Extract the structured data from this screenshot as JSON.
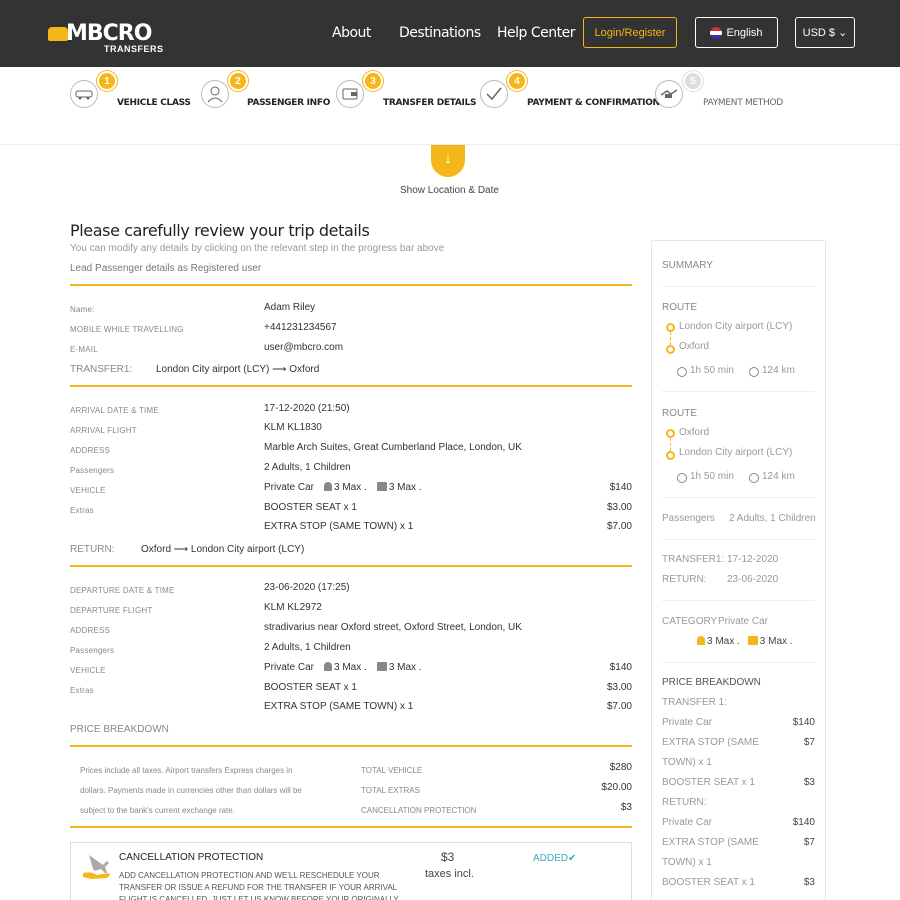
{
  "header": {
    "logo_text": "MBCRO",
    "logo_sub": "TRANSFERS",
    "nav": [
      "About",
      "Destinations",
      "Help Center"
    ],
    "login_label": "Login/Register",
    "language_label": "English",
    "currency_label": "USD $ ⌄"
  },
  "steps": [
    {
      "num": "1",
      "label": "VEHICLE CLASS",
      "icon": "car-icon"
    },
    {
      "num": "2",
      "label": "PASSENGER INFO",
      "icon": "user-icon"
    },
    {
      "num": "3",
      "label": "TRANSFER DETAILS",
      "icon": "wallet-icon"
    },
    {
      "num": "4",
      "label": "PAYMENT & CONFIRMATION",
      "icon": "check-icon"
    },
    {
      "num": "5",
      "label": "PAYMENT METHOD",
      "icon": "handshake-icon"
    }
  ],
  "location_toggle": {
    "icon": "↓",
    "label": "Show Location & Date"
  },
  "review": {
    "title": "Please carefully review your trip details",
    "subtitle": "You can modify any details by clicking on the relevant step in the progress bar above",
    "lead": "Lead Passenger details as Registered user",
    "passenger": {
      "name_label": "Name:",
      "name": "Adam Riley",
      "mobile_label": "MOBILE WHILE TRAVELLING",
      "mobile": "+441231234567",
      "email_label": "E-MAIL",
      "email": "user@mbcro.com"
    },
    "transfer1": {
      "label": "TRANSFER1:",
      "route": "London City airport (LCY) ⟶ Oxford",
      "date_label": "ARRIVAL DATE & TIME",
      "date": "17-12-2020 (21:50)",
      "flight_label": "ARRIVAL FLIGHT",
      "flight": "KLM KL1830",
      "address_label": "ADDRESS",
      "address": "Marble Arch Suites, Great Cumberland Place, London, UK",
      "passengers_label": "Passengers",
      "passengers": "2 Adults, 1 Children",
      "vehicle_label": "VEHICLE",
      "vehicle": "Private Car",
      "pax_max": "3 Max .",
      "bag_max": "3 Max .",
      "vehicle_price": "$140",
      "extras_label": "Extras",
      "extra1": "BOOSTER SEAT x 1",
      "extra1_price": "$3.00",
      "extra2": "EXTRA STOP (SAME TOWN) x 1",
      "extra2_price": "$7.00"
    },
    "return": {
      "label": "RETURN:",
      "route": "Oxford ⟶ London City airport (LCY)",
      "date_label": "DEPARTURE DATE & TIME",
      "date": "23-06-2020 (17:25)",
      "flight_label": "DEPARTURE FLIGHT",
      "flight": "KLM KL2972",
      "address_label": "ADDRESS",
      "address": "stradivarius near Oxford street, Oxford Street, London, UK",
      "passengers_label": "Passengers",
      "passengers": "2 Adults, 1 Children",
      "vehicle_label": "VEHICLE",
      "vehicle": "Private Car",
      "pax_max": "3 Max .",
      "bag_max": "3 Max .",
      "vehicle_price": "$140",
      "extras_label": "Extras",
      "extra1": "BOOSTER SEAT x 1",
      "extra1_price": "$3.00",
      "extra2": "EXTRA STOP (SAME TOWN) x 1",
      "extra2_price": "$7.00"
    },
    "price_breakdown": {
      "label": "PRICE BREAKDOWN",
      "note1": "Prices include all taxes. Airport transfers Express charges in",
      "note2": "dollars. Payments made in currencies other than dollars will be",
      "note3": "subject to the bank's current exchange rate.",
      "total_vehicle_label": "TOTAL VEHICLE",
      "total_vehicle": "$280",
      "total_extras_label": "TOTAL EXTRAS",
      "total_extras": "$20.00",
      "cancellation_label": "CANCELLATION PROTECTION",
      "cancellation": "$3"
    },
    "cancellation": {
      "title": "CANCELLATION PROTECTION",
      "desc": "ADD CANCELLATION PROTECTION AND WE'LL RESCHEDULE YOUR TRANSFER OR ISSUE A REFUND FOR THE TRANSFER IF YOUR ARRIVAL FLIGHT IS CANCELLED. JUST LET US KNOW BEFORE YOUR ORIGINALLY SCHEDULED",
      "price": "$3",
      "incl": "taxes incl.",
      "added": "ADDED✔"
    }
  },
  "summary": {
    "title": "SUMMARY",
    "route1": {
      "label": "ROUTE",
      "from": "London City airport (LCY)",
      "to": "Oxford",
      "time": "1h 50 min",
      "dist": "124 km"
    },
    "route2": {
      "label": "ROUTE",
      "from": "Oxford",
      "to": "London City airport (LCY)",
      "time": "1h 50 min",
      "dist": "124 km"
    },
    "passengers_label": "Passengers",
    "passengers": "2 Adults, 1 Children",
    "transfer1_label": "TRANSFER1:",
    "transfer1_date": "17-12-2020",
    "return_label": "RETURN:",
    "return_date": "23-06-2020",
    "category_label": "CATEGORY",
    "category": "Private Car",
    "pax_max": "3 Max .",
    "bag_max": "3 Max .",
    "pb_label": "PRICE BREAKDOWN",
    "pb_transfer1": "TRANSFER 1:",
    "pb_car": "Private Car",
    "pb_car_price": "$140",
    "pb_stop_1": "EXTRA STOP (SAME",
    "pb_stop_2": "TOWN) x 1",
    "pb_stop_price": "$7",
    "pb_booster": "BOOSTER SEAT x 1",
    "pb_booster_price": "$3",
    "pb_return": "RETURN:",
    "pb_car2": "Private Car",
    "pb_car2_price": "$140",
    "pb_stop2_1": "EXTRA STOP (SAME",
    "pb_stop2_2": "TOWN) x 1",
    "pb_stop2_price": "$7",
    "pb_booster2": "BOOSTER SEAT x 1",
    "pb_booster2_price": "$3"
  },
  "colors": {
    "accent": "#f5b61a",
    "header_bg": "#333333",
    "added": "#3aa9b8"
  }
}
